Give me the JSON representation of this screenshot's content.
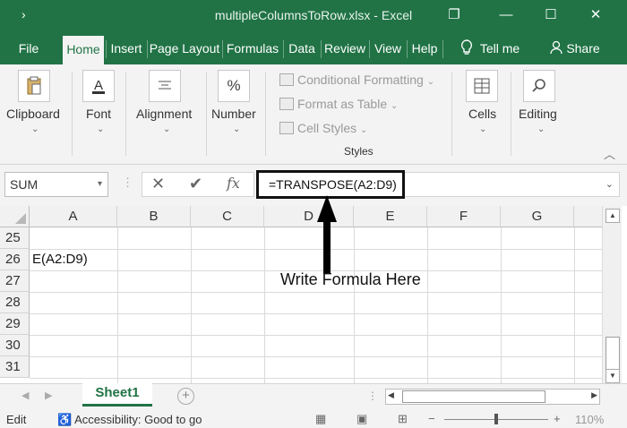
{
  "window": {
    "title": "multipleColumnsToRow.xlsx - Excel",
    "quick_access": "›",
    "restore_glyph": "❐",
    "minimize_glyph": "—",
    "maximize_glyph": "☐",
    "close_glyph": "✕"
  },
  "ribbon_tabs": [
    "File",
    "Home",
    "Insert",
    "Page Layout",
    "Formulas",
    "Data",
    "Review",
    "View",
    "Help",
    "Tell me",
    "Share"
  ],
  "ribbon_groups": {
    "clipboard": "Clipboard",
    "font": "Font",
    "alignment": "Alignment",
    "number": "Number",
    "conditional_formatting": "Conditional Formatting",
    "format_as_table": "Format as Table",
    "cell_styles": "Cell Styles",
    "styles": "Styles",
    "cells": "Cells",
    "editing": "Editing"
  },
  "icons": {
    "clipboard": "clipboard-icon",
    "font": "font-A-icon",
    "alignment": "align-icon",
    "number": "percent-icon",
    "cells": "cells-icon",
    "editing": "search-icon"
  },
  "formula_bar": {
    "name_box": "SUM",
    "cancel": "✕",
    "enter": "✔",
    "fx": "fx",
    "formula": "=TRANSPOSE(A2:D9)"
  },
  "grid": {
    "columns": [
      "A",
      "B",
      "C",
      "D",
      "E",
      "F",
      "G"
    ],
    "rows": [
      "25",
      "26",
      "27",
      "28",
      "29",
      "30",
      "31"
    ],
    "cell_A26": "E(A2:D9)"
  },
  "annotation": "Write Formula Here",
  "sheet_tabs": [
    "Sheet1"
  ],
  "status": {
    "mode": "Edit",
    "accessibility": "Accessibility: Good to go",
    "zoom": "110%"
  },
  "colors": {
    "excel_green": "#217346",
    "ribbon_bg": "#f3f3f3"
  }
}
